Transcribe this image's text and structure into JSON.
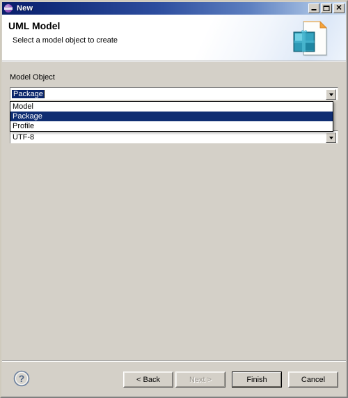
{
  "window": {
    "title": "New",
    "icon": "eclipse-globe-icon",
    "controls": {
      "minimize": "minimize-icon",
      "maximize": "maximize-icon",
      "close": "close-icon"
    }
  },
  "header": {
    "title": "UML Model",
    "subtitle": "Select a model object to create",
    "icon": "uml-model-wizard-icon"
  },
  "form": {
    "model_object": {
      "label": "Model Object",
      "value": "Package",
      "value_selected": true,
      "options": [
        "Model",
        "Package",
        "Profile"
      ],
      "highlighted_option": "Package"
    },
    "encoding": {
      "value": "UTF-8"
    }
  },
  "buttons": {
    "help": "?",
    "back": "< Back",
    "next": "Next >",
    "next_enabled": false,
    "finish": "Finish",
    "finish_default": true,
    "cancel": "Cancel"
  },
  "colors": {
    "titlebar_start": "#0a1f6b",
    "titlebar_end": "#cfe0f4",
    "dialog_face": "#d4d0c8",
    "selection": "#0a246a",
    "list_selection": "#0f2d72",
    "icon_teal": "#2a93ad",
    "icon_fold": "#f0a030"
  }
}
